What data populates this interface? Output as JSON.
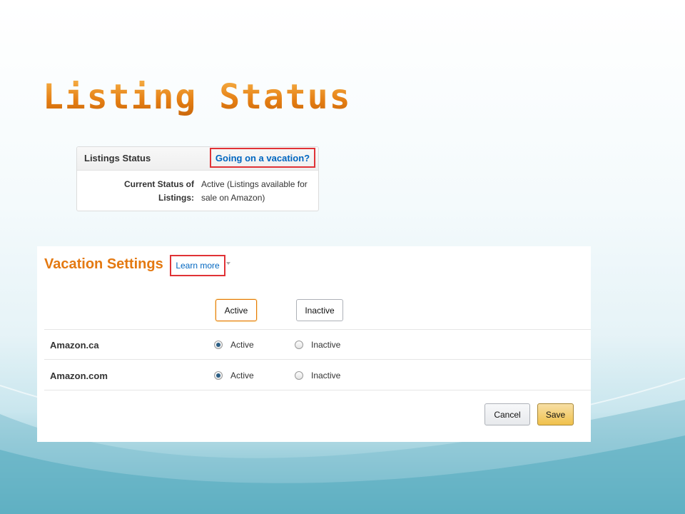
{
  "slide": {
    "title": "Listing Status"
  },
  "listings_status": {
    "header_title": "Listings Status",
    "vacation_link": "Going on a vacation?",
    "current_status_label": "Current Status of Listings:",
    "current_status_value": "Active (Listings available for sale on Amazon)"
  },
  "vacation_settings": {
    "title": "Vacation Settings",
    "learn_more": "Learn more",
    "set_all_active": "Active",
    "set_all_inactive": "Inactive",
    "marketplaces": [
      {
        "name": "Amazon.ca",
        "active_label": "Active",
        "inactive_label": "Inactive",
        "selected": "Active"
      },
      {
        "name": "Amazon.com",
        "active_label": "Active",
        "inactive_label": "Inactive",
        "selected": "Active"
      }
    ],
    "cancel_label": "Cancel",
    "save_label": "Save"
  },
  "colors": {
    "title_orange": "#e47911",
    "link_blue": "#0066c0",
    "highlight_red": "#e03236",
    "save_yellow": "#f0c14b"
  },
  "icons": {
    "dropdown": "caret-down-icon"
  }
}
